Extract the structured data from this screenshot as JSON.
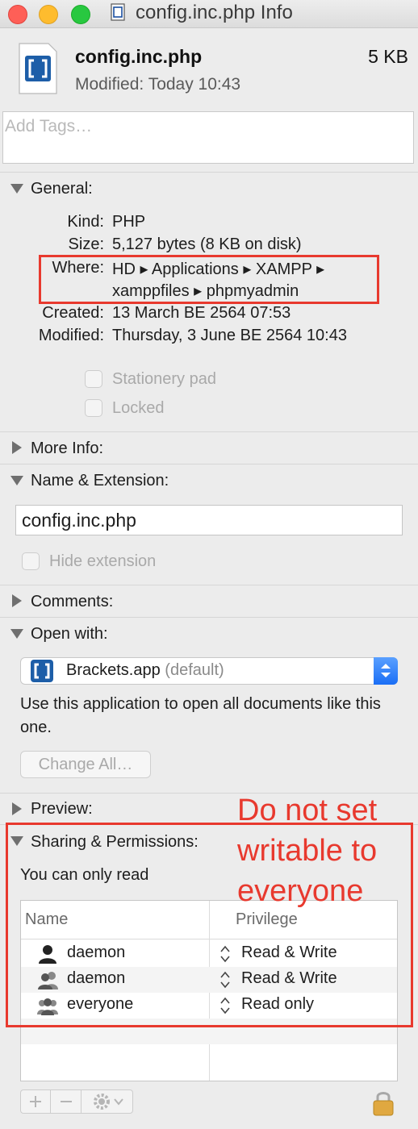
{
  "window": {
    "title": "config.inc.php Info"
  },
  "header": {
    "file_name": "config.inc.php",
    "file_size": "5 KB",
    "modified_label": "Modified:",
    "modified_value": "Today 10:43",
    "tags_placeholder": "Add Tags…"
  },
  "general": {
    "label": "General:",
    "rows": [
      {
        "key": "Kind:",
        "value": "PHP"
      },
      {
        "key": "Size:",
        "value": "5,127 bytes (8 KB on disk)"
      },
      {
        "key": "Where:",
        "value_line1": "HD ▸ Applications ▸ XAMPP ▸",
        "value_line2": "xamppfiles ▸ phpmyadmin"
      },
      {
        "key": "Created:",
        "value": "13 March BE 2564 07:53"
      },
      {
        "key": "Modified:",
        "value": "Thursday, 3 June BE 2564 10:43"
      }
    ],
    "stationery_label": "Stationery pad",
    "locked_label": "Locked"
  },
  "more_info": {
    "label": "More Info:"
  },
  "name_ext": {
    "label": "Name & Extension:",
    "value": "config.inc.php",
    "hide_ext_label": "Hide extension"
  },
  "comments": {
    "label": "Comments:"
  },
  "open_with": {
    "label": "Open with:",
    "app": "Brackets.app",
    "default_tag": "(default)",
    "description": "Use this application to open all documents like this one.",
    "change_all": "Change All…"
  },
  "preview": {
    "label": "Preview:"
  },
  "sharing": {
    "label": "Sharing & Permissions:",
    "note": "You can only read",
    "columns": {
      "name": "Name",
      "privilege": "Privilege"
    },
    "rows": [
      {
        "name": "daemon",
        "privilege": "Read & Write",
        "icon": "single-user-icon"
      },
      {
        "name": "daemon",
        "privilege": "Read & Write",
        "icon": "group-icon"
      },
      {
        "name": "everyone",
        "privilege": "Read only",
        "icon": "everyone-icon"
      }
    ]
  },
  "annotation": {
    "line1": "Do not set",
    "line2": "writable to",
    "line3": "everyone",
    "color": "#e8392e"
  },
  "colors": {
    "accent": "#1a6ef5",
    "annotation": "#e8392e"
  }
}
